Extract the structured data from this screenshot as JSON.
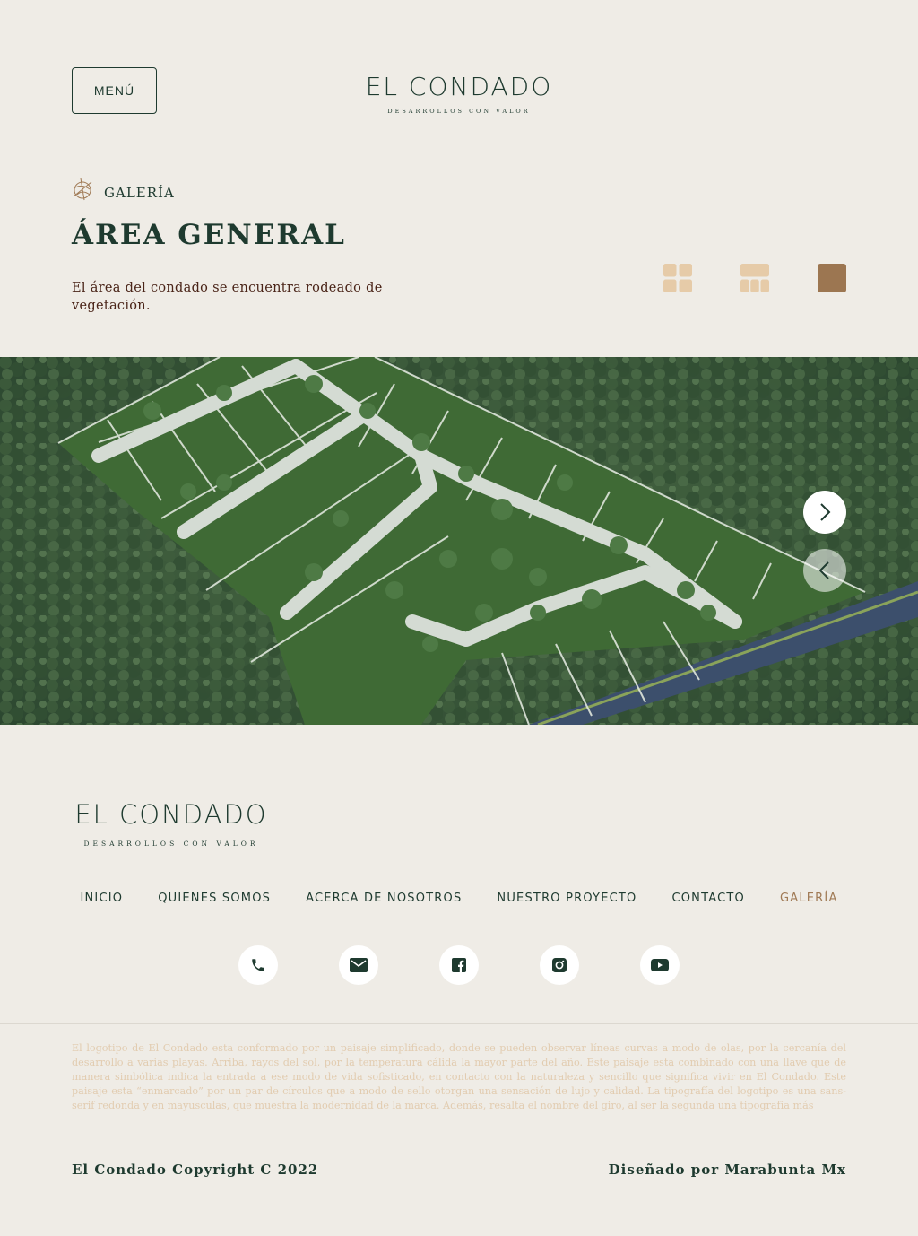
{
  "header": {
    "menu_label": "MENÚ",
    "logo_name": "EL CONDADO",
    "logo_tagline": "DESARROLLOS CON VALOR"
  },
  "gallery": {
    "eyebrow": "GALERÍA",
    "title": "ÁREA GENERAL",
    "description": "El área del condado se encuentra rodeado de vegetación.",
    "view_toggles": [
      "grid-2x2-icon",
      "grid-1x3-icon",
      "single-view-icon"
    ],
    "active_view": "single-view-icon"
  },
  "carousel": {
    "next_icon": "chevron-right-icon",
    "prev_icon": "chevron-left-icon"
  },
  "footer": {
    "logo_name": "EL CONDADO",
    "logo_tagline": "DESARROLLOS CON VALOR",
    "nav": [
      {
        "label": "INICIO",
        "active": false
      },
      {
        "label": "QUIENES SOMOS",
        "active": false
      },
      {
        "label": "ACERCA DE NOSOTROS",
        "active": false
      },
      {
        "label": "NUESTRO PROYECTO",
        "active": false
      },
      {
        "label": "CONTACTO",
        "active": false
      },
      {
        "label": "GALERÍA",
        "active": true
      }
    ],
    "socials": [
      "phone-icon",
      "mail-icon",
      "facebook-icon",
      "instagram-icon",
      "youtube-icon"
    ],
    "blurb": "El logotipo de El Condado esta conformado por un paisaje simplificado, donde se pueden observar líneas curvas a modo de olas, por la cercanía del desarrollo a varias playas. Arriba, rayos del sol, por la temperatura cálida la mayor parte del año. Este paisaje esta combinado con una llave que de manera simbólica indica la entrada a ese modo de vida sofisticado, en contacto con la naturaleza y sencillo que significa vivir en El Condado. Este paisaje esta “enmarcado” por un par de círculos que a modo de sello otorgan una sensación de lujo y calidad. La tipografía del logotipo es una sans-serif redonda y en mayusculas, que muestra la modernidad de la marca. Además, resalta el nombre del giro, al ser la segunda una tipografía más",
    "copyright": "El Condado Copyright C 2022",
    "credit": "Diseñado por Marabunta Mx"
  },
  "colors": {
    "background": "#efece6",
    "primary_green": "#1e3a2f",
    "accent_brown": "#a07a55",
    "toggle_inactive": "#e6cba8",
    "toggle_active": "#9c7651"
  }
}
